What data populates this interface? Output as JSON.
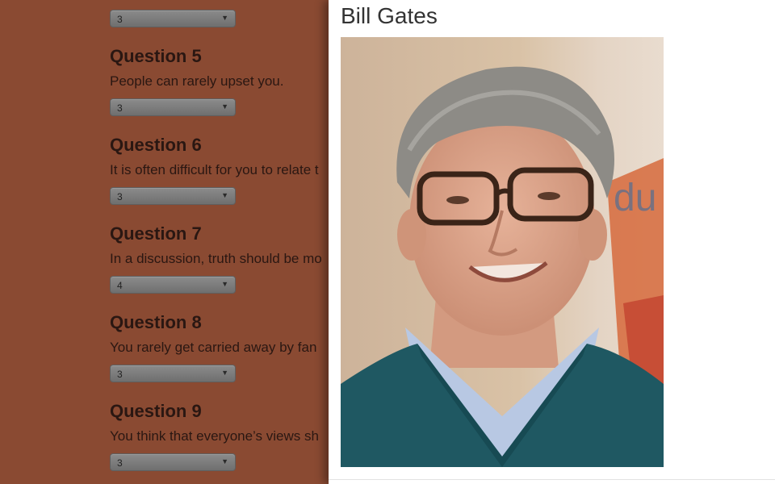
{
  "quiz": {
    "top_select_value": "3",
    "questions": [
      {
        "title": "Question 5",
        "text": "People can rarely upset you.",
        "value": "3"
      },
      {
        "title": "Question 6",
        "text": "It is often difficult for you to relate t",
        "value": "3"
      },
      {
        "title": "Question 7",
        "text": "In a discussion, truth should be mo",
        "value": "4"
      },
      {
        "title": "Question 8",
        "text": "You rarely get carried away by fan",
        "value": "3"
      },
      {
        "title": "Question 9",
        "text": "You think that everyone’s views sh",
        "value": "3"
      }
    ]
  },
  "modal": {
    "title": "Bill Gates"
  },
  "colors": {
    "overlay_background": "#8a4a32",
    "modal_background": "#ffffff"
  },
  "icons": {
    "select_arrow": "chevron-down-icon"
  }
}
